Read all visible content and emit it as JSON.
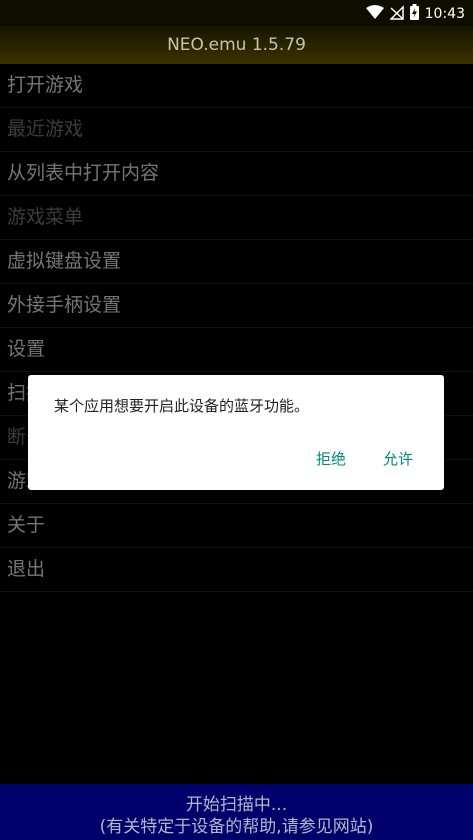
{
  "status_bar": {
    "time": "10:43",
    "icons": [
      "wifi-icon",
      "signal-off-icon",
      "battery-charging-icon"
    ]
  },
  "app": {
    "title": "NEO.emu  1.5.79"
  },
  "menu": {
    "items": [
      {
        "label": "打开游戏",
        "enabled": true
      },
      {
        "label": "最近游戏",
        "enabled": false
      },
      {
        "label": "从列表中打开内容",
        "enabled": true
      },
      {
        "label": "游戏菜单",
        "enabled": false
      },
      {
        "label": "虚拟键盘设置",
        "enabled": true
      },
      {
        "label": "外接手柄设置",
        "enabled": true
      },
      {
        "label": "设置",
        "enabled": true
      },
      {
        "label": "扫描",
        "enabled": true
      },
      {
        "label": "断开",
        "enabled": false
      },
      {
        "label": "游戏截图",
        "enabled": true
      },
      {
        "label": "关于",
        "enabled": true
      },
      {
        "label": "退出",
        "enabled": true
      }
    ]
  },
  "dialog": {
    "message": "某个应用想要开启此设备的蓝牙功能。",
    "deny_label": "拒绝",
    "allow_label": "允许",
    "accent_color": "#00897b"
  },
  "bottom_bar": {
    "line1": "开始扫描中...",
    "line2": "(有关特定于设备的帮助,请参见网站)"
  },
  "colors": {
    "bottom_bar_bg": "#00006c",
    "titlebar_bg": "#3a3300"
  }
}
